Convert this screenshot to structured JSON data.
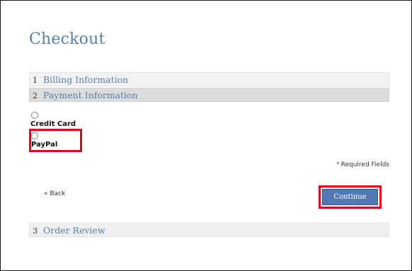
{
  "page": {
    "title": "Checkout"
  },
  "sections": [
    {
      "number": "1",
      "label": "Billing Information"
    },
    {
      "number": "2",
      "label": "Payment Information"
    },
    {
      "number": "3",
      "label": "Order Review"
    }
  ],
  "payment": {
    "options": [
      {
        "label": "Credit Card",
        "selected": false
      },
      {
        "label": "PayPal",
        "selected": false,
        "highlighted": true
      }
    ],
    "required_note": "Required Fields",
    "required_star": "*",
    "back_label": "« Back",
    "continue_label": "Continue"
  },
  "colors": {
    "heading": "#5a7fa6",
    "highlight": "#e0001b",
    "button": "#4a73b0"
  }
}
